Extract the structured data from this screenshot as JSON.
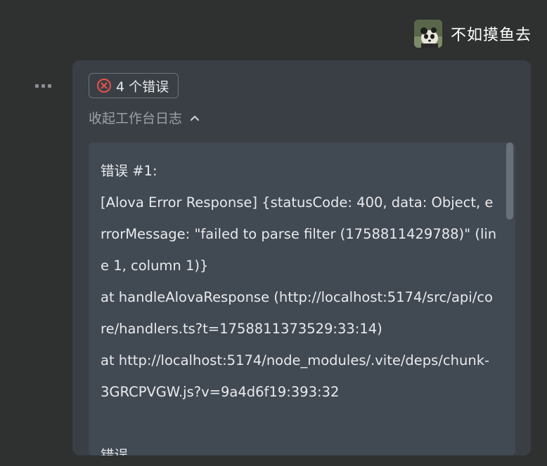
{
  "user": {
    "name": "不如摸鱼去",
    "avatar_icon": "panda-avatar"
  },
  "message": {
    "more_icon": "more-dots-icon",
    "error_badge": {
      "icon": "error-circle-x-icon",
      "label": "4 个错误",
      "color": "#e5534b"
    },
    "collapse": {
      "label": "收起工作台日志",
      "icon": "chevron-up-icon"
    },
    "log": {
      "lines": [
        "错误 #1:",
        "[Alova Error Response] {statusCode: 400, data: Object, errorMessage: \"failed to parse filter (1758811429788)\" (line 1, column 1)}",
        "at handleAlovaResponse (http://localhost:5174/src/api/core/handlers.ts?t=1758811373529:33:14)",
        "at http://localhost:5174/node_modules/.vite/deps/chunk-3GRCPVGW.js?v=9a4d6f19:393:32",
        "",
        "错误"
      ]
    }
  }
}
